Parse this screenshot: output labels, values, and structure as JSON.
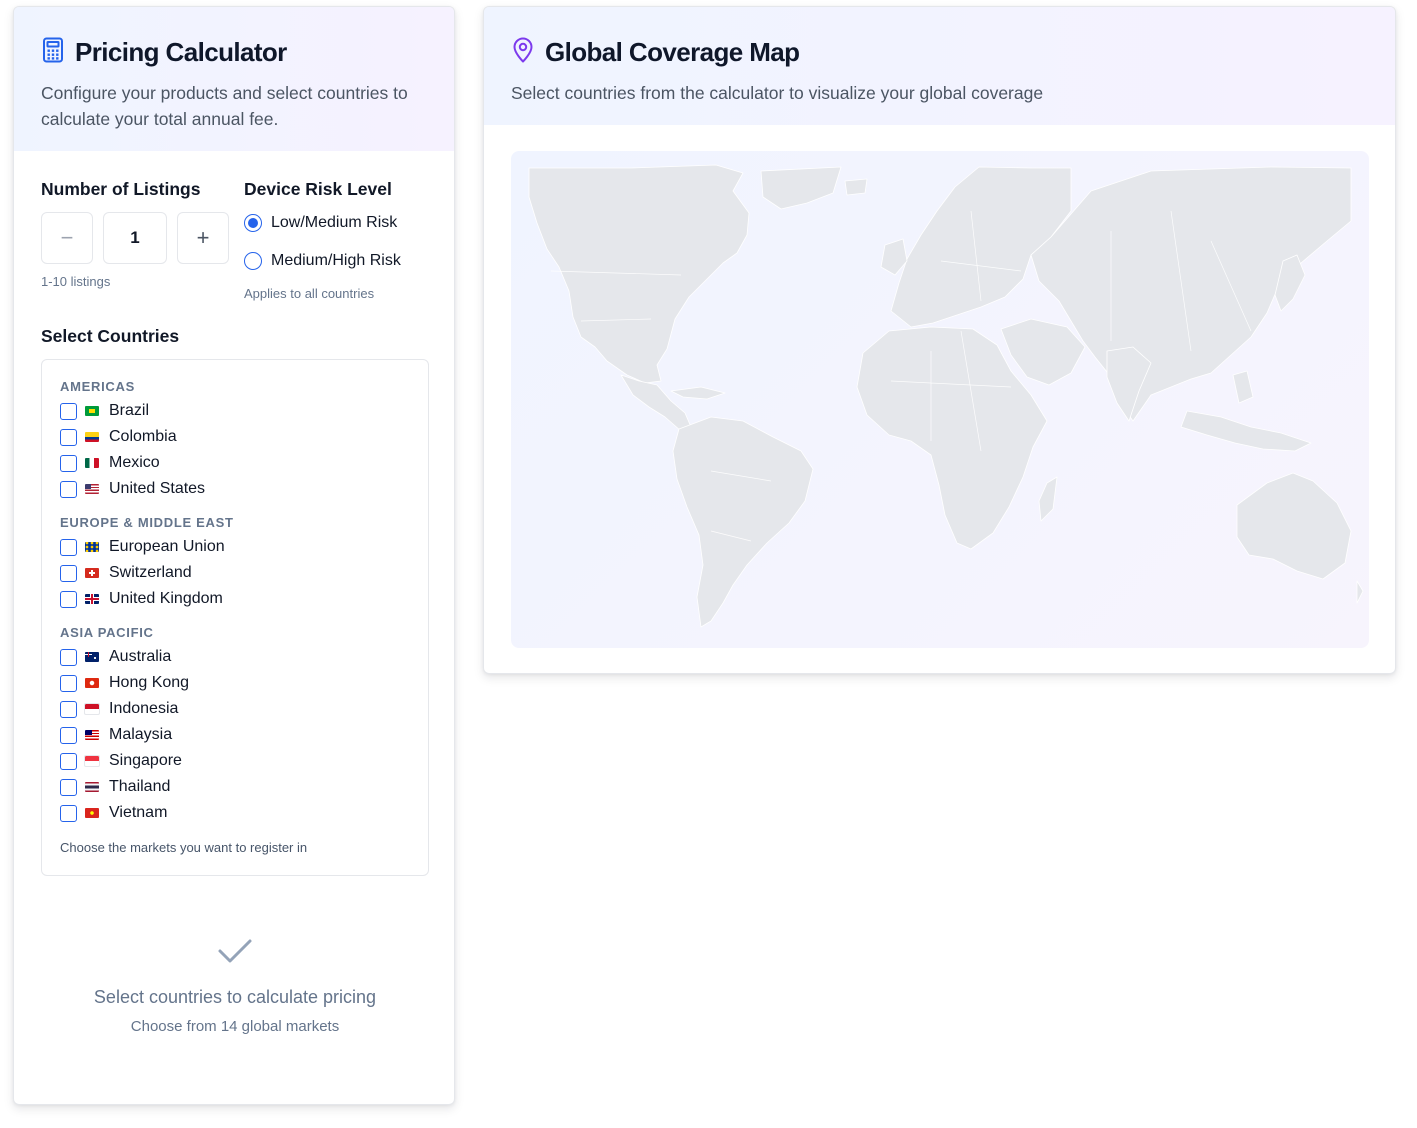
{
  "calculator": {
    "title": "Pricing Calculator",
    "icon": "calculator-icon",
    "subtitle": "Configure your products and select countries to calculate your total annual fee.",
    "listings": {
      "label": "Number of Listings",
      "value": "1",
      "minus": "−",
      "plus": "+",
      "hint": "1-10 listings"
    },
    "risk": {
      "label": "Device Risk Level",
      "options": [
        {
          "label": "Low/Medium Risk",
          "selected": true
        },
        {
          "label": "Medium/High Risk",
          "selected": false
        }
      ],
      "hint": "Applies to all countries"
    },
    "countries": {
      "label": "Select Countries",
      "regions": [
        {
          "name": "AMERICAS",
          "items": [
            {
              "name": "Brazil",
              "flag": "brazil-flag-icon",
              "checked": false
            },
            {
              "name": "Colombia",
              "flag": "colombia-flag-icon",
              "checked": false
            },
            {
              "name": "Mexico",
              "flag": "mexico-flag-icon",
              "checked": false
            },
            {
              "name": "United States",
              "flag": "us-flag-icon",
              "checked": false
            }
          ]
        },
        {
          "name": "EUROPE & MIDDLE EAST",
          "items": [
            {
              "name": "European Union",
              "flag": "eu-flag-icon",
              "checked": false
            },
            {
              "name": "Switzerland",
              "flag": "switzerland-flag-icon",
              "checked": false
            },
            {
              "name": "United Kingdom",
              "flag": "uk-flag-icon",
              "checked": false
            }
          ]
        },
        {
          "name": "ASIA PACIFIC",
          "items": [
            {
              "name": "Australia",
              "flag": "australia-flag-icon",
              "checked": false
            },
            {
              "name": "Hong Kong",
              "flag": "hong-kong-flag-icon",
              "checked": false
            },
            {
              "name": "Indonesia",
              "flag": "indonesia-flag-icon",
              "checked": false
            },
            {
              "name": "Malaysia",
              "flag": "malaysia-flag-icon",
              "checked": false
            },
            {
              "name": "Singapore",
              "flag": "singapore-flag-icon",
              "checked": false
            },
            {
              "name": "Thailand",
              "flag": "thailand-flag-icon",
              "checked": false
            },
            {
              "name": "Vietnam",
              "flag": "vietnam-flag-icon",
              "checked": false
            }
          ]
        }
      ],
      "hint": "Choose the markets you want to register in"
    },
    "empty_state": {
      "icon": "checkmark-icon",
      "title": "Select countries to calculate pricing",
      "subtitle": "Choose from 14 global markets"
    }
  },
  "map": {
    "title": "Global Coverage Map",
    "icon": "map-pin-icon",
    "subtitle": "Select countries from the calculator to visualize your global coverage"
  },
  "colors": {
    "accent_blue": "#2563eb",
    "accent_purple": "#7c3aed",
    "land": "#e5e7eb",
    "muted_text": "#64748b"
  }
}
